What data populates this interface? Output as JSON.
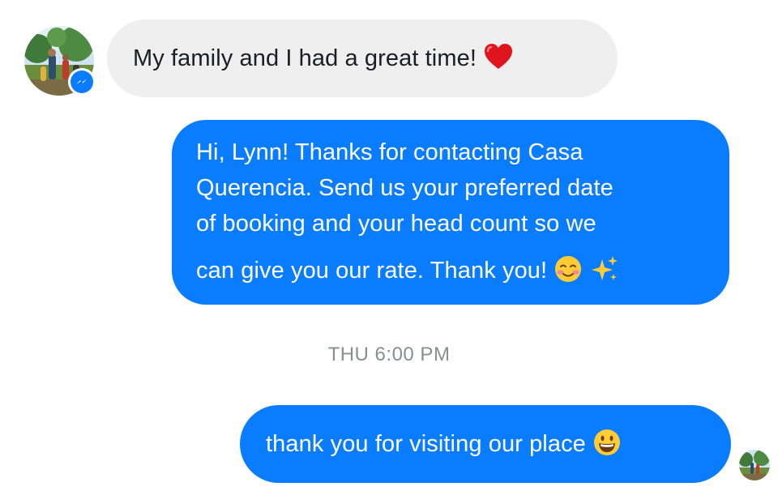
{
  "contact": {
    "avatar_icon": "profile-photo-icon",
    "badge_icon": "messenger-icon",
    "accent_color": "#0a7cff"
  },
  "messages": [
    {
      "direction": "incoming",
      "text": "My family and I had a great time!",
      "emoji": "red-heart-emoji",
      "bubble_color": "#efefef"
    },
    {
      "direction": "outgoing",
      "lines": [
        "Hi, Lynn! Thanks for contacting Casa",
        "Querencia. Send us your preferred date",
        "of booking and your head count so we",
        "can give you our rate. Thank you!"
      ],
      "emojis": [
        "smiling-face-emoji",
        "sparkles-emoji"
      ],
      "bubble_color": "#0a7cff"
    },
    {
      "direction": "outgoing",
      "text": "thank you for visiting our place",
      "emoji": "grinning-face-emoji",
      "bubble_color": "#0a7cff"
    }
  ],
  "timestamp": "THU 6:00 PM",
  "seen_indicator_icon": "seen-avatar-icon"
}
